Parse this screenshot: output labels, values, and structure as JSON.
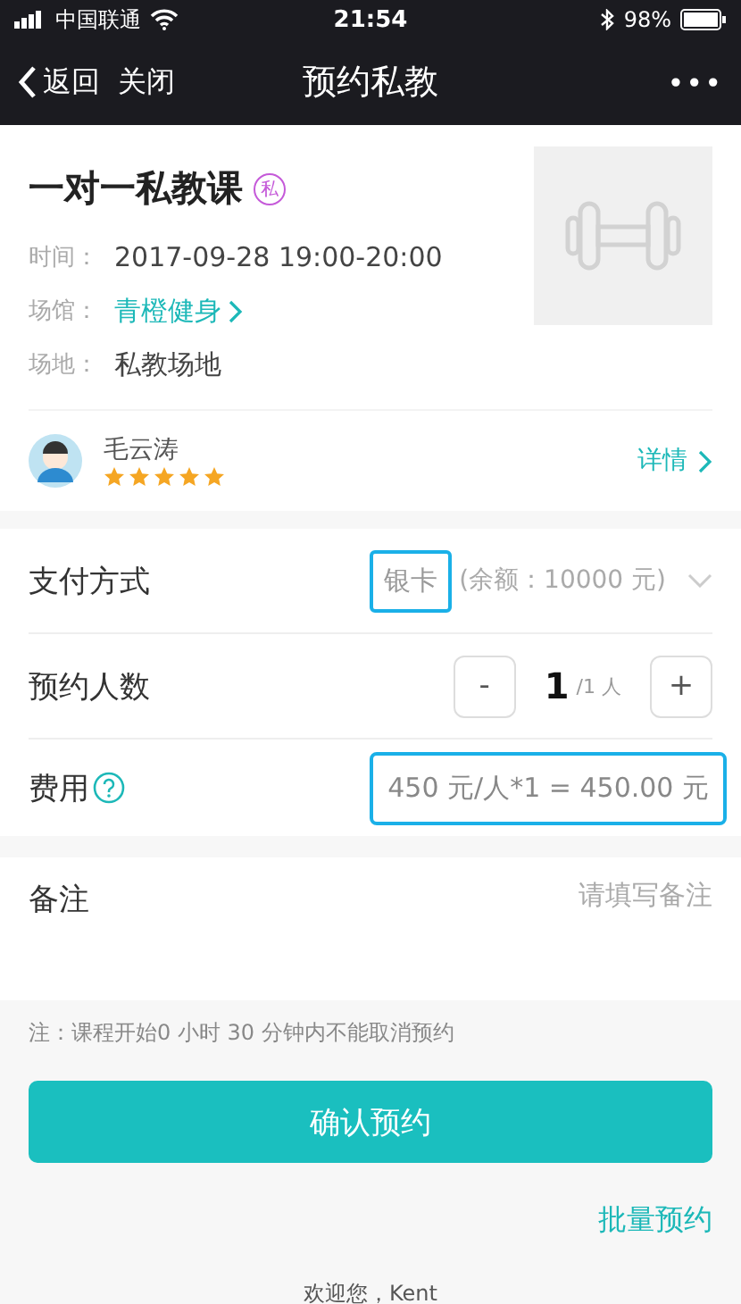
{
  "status_bar": {
    "carrier": "中国联通",
    "time": "21:54",
    "battery": "98%"
  },
  "nav": {
    "back": "返回",
    "close": "关闭",
    "title": "预约私教",
    "more": "•••"
  },
  "course": {
    "title": "一对一私教课",
    "badge": "私",
    "fields": [
      {
        "label": "时间：",
        "value": "2017-09-28 19:00-20:00",
        "kind": "text"
      },
      {
        "label": "场馆：",
        "value": "青橙健身",
        "kind": "link"
      },
      {
        "label": "场地：",
        "value": "私教场地",
        "kind": "text"
      }
    ],
    "coach": {
      "name": "毛云涛",
      "stars": 5,
      "detail": "详情"
    }
  },
  "payment": {
    "label": "支付方式",
    "method": "银卡",
    "method_highlighted": true,
    "balance": "(余额：10000 元)"
  },
  "people": {
    "label": "预约人数",
    "minus": "-",
    "count": "1",
    "limit": "/1 人",
    "plus": "+"
  },
  "fee": {
    "label": "费用",
    "formula": "450 元/人*1 = 450.00 元",
    "highlighted": true
  },
  "remark": {
    "label": "备注",
    "placeholder": "请填写备注"
  },
  "note": "注：课程开始0 小时 30 分钟内不能取消预约",
  "confirm": "确认预约",
  "batch": "批量预约",
  "welcome": "欢迎您，Kent"
}
